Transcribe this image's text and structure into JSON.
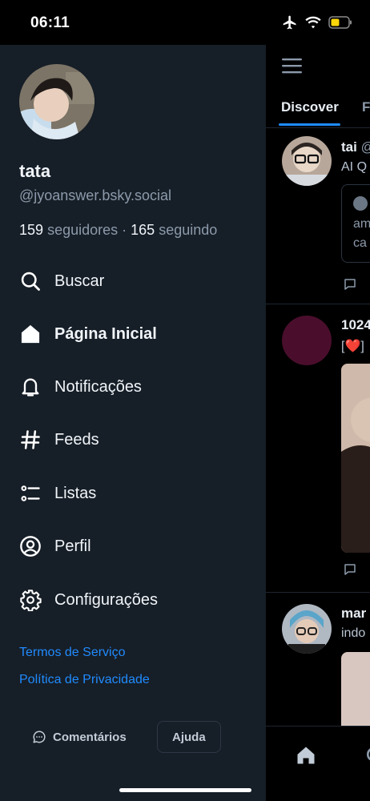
{
  "status_bar": {
    "time": "06:11"
  },
  "profile": {
    "name": "tata",
    "handle": "@jyoanswer.bsky.social",
    "followers_count": "159",
    "followers_label": "seguidores",
    "separator": "·",
    "following_count": "165",
    "following_label": "seguindo"
  },
  "menu": [
    {
      "label": "Buscar",
      "icon": "search-icon"
    },
    {
      "label": "Página Inicial",
      "icon": "home-icon"
    },
    {
      "label": "Notificações",
      "icon": "bell-icon"
    },
    {
      "label": "Feeds",
      "icon": "hash-icon"
    },
    {
      "label": "Listas",
      "icon": "list-icon"
    },
    {
      "label": "Perfil",
      "icon": "user-circle-icon"
    },
    {
      "label": "Configurações",
      "icon": "gear-icon"
    }
  ],
  "links": {
    "terms": "Termos de Serviço",
    "privacy": "Política de Privacidade"
  },
  "footer": {
    "feedback": "Comentários",
    "help": "Ajuda"
  },
  "feed": {
    "tabs": [
      "Discover",
      "F"
    ],
    "posts": [
      {
        "handle": "tai",
        "handle_suffix": "@",
        "text": "AI Q",
        "quote_lines": [
          "am",
          "ca"
        ]
      },
      {
        "handle": "1024",
        "text": "[❤️]"
      },
      {
        "handle": "mar",
        "text": "indo"
      }
    ]
  },
  "colors": {
    "accent": "#208bfe",
    "drawer_bg": "#161e27",
    "muted_text": "#8c9aab"
  }
}
